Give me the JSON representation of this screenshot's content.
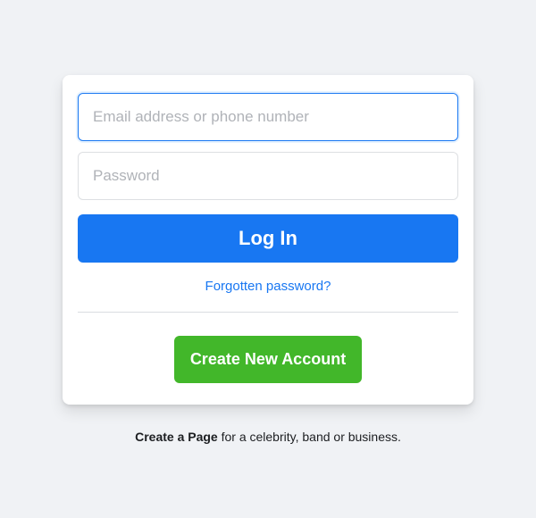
{
  "login": {
    "email_placeholder": "Email address or phone number",
    "password_placeholder": "Password",
    "login_button": "Log In",
    "forgot_password": "Forgotten password?",
    "create_account": "Create New Account"
  },
  "footer": {
    "create_page_link": "Create a Page",
    "create_page_text": " for a celebrity, band or business."
  }
}
